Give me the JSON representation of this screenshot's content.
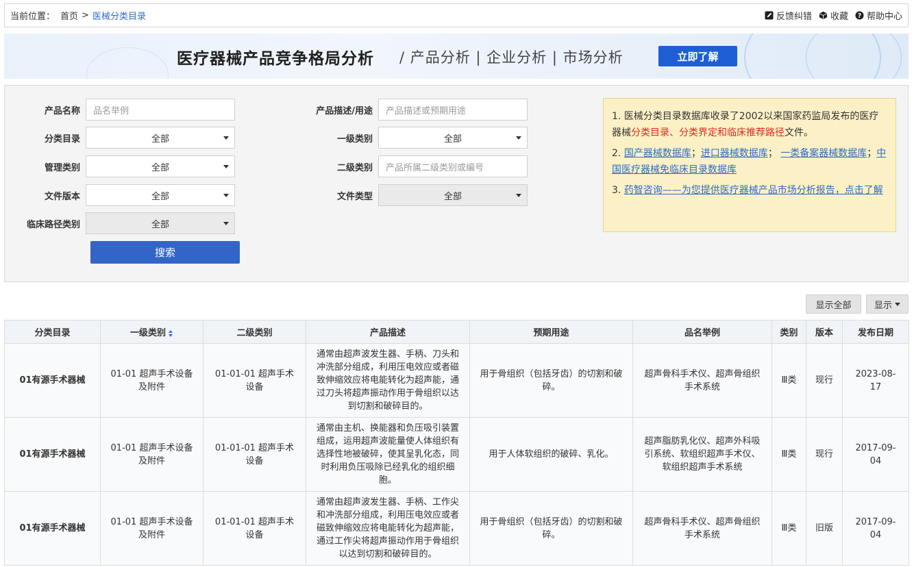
{
  "breadcrumb": {
    "label": "当前位置：",
    "home": "首页",
    "separator": ">",
    "current": "医械分类目录"
  },
  "tools": {
    "feedback": "反馈纠错",
    "favorite": "收藏",
    "help": "帮助中心"
  },
  "banner": {
    "title": "医疗器械产品竞争格局分析",
    "subtitle": "/ 产品分析 | 企业分析 | 市场分析",
    "button": "立即了解"
  },
  "form": {
    "product_name": {
      "label": "产品名称",
      "placeholder": "品名举例"
    },
    "catalog": {
      "label": "分类目录",
      "value": "全部"
    },
    "management": {
      "label": "管理类别",
      "value": "全部"
    },
    "file_version": {
      "label": "文件版本",
      "value": "全部"
    },
    "clinical_path": {
      "label": "临床路径类别",
      "value": "全部"
    },
    "description": {
      "label": "产品描述/用途",
      "placeholder": "产品描述或预期用途"
    },
    "level1": {
      "label": "一级类别",
      "value": "全部"
    },
    "level2": {
      "label": "二级类别",
      "placeholder": "产品所属二级类别或编号"
    },
    "file_type": {
      "label": "文件类型",
      "value": "全部"
    },
    "search_button": "搜索"
  },
  "notice": {
    "line1_a": "1. 医械分类目录数据库收录了2002以来国家药监局发布的医疗器械",
    "line1_red": "分类目录、分类界定和临床推荐路径",
    "line1_b": "文件。",
    "line2_prefix": "2. ",
    "link_domestic": "国产器械数据库",
    "sep1": "；",
    "link_import": "进口器械数据库",
    "sep2": "；",
    "link_class1": "一类备案器械数据库",
    "sep3": "；",
    "link_exempt": "中国医疗器械免临床目录数据库",
    "line3_prefix": "3. ",
    "link_consult": "药智咨询——为您提供医疗器械产品市场分析报告，点击了解"
  },
  "table_controls": {
    "show_all": "显示全部",
    "display": "显示"
  },
  "table": {
    "headers": [
      "分类目录",
      "一级类别",
      "二级类别",
      "产品描述",
      "预期用途",
      "品名举例",
      "类别",
      "版本",
      "发布日期"
    ],
    "rows": [
      {
        "catalog": "01有源手术器械",
        "level1": "01-01 超声手术设备及附件",
        "level2": "01-01-01 超声手术设备",
        "description": "通常由超声波发生器、手柄、刀头和冲洗部分组成，利用压电效应或者磁致伸缩效应将电能转化为超声能，通过刀头将超声振动作用于骨组织以达到切割和破碎目的。",
        "usage": "用于骨组织（包括牙齿）的切割和破碎。",
        "examples": "超声骨科手术仪、超声骨组织手术系统",
        "class": "Ⅲ类",
        "version": "现行",
        "date": "2023-08-17"
      },
      {
        "catalog": "01有源手术器械",
        "level1": "01-01 超声手术设备及附件",
        "level2": "01-01-01 超声手术设备",
        "description": "通常由主机、换能器和负压吸引装置组成，运用超声波能量使人体组织有选择性地被破碎，使其呈乳化态，同时利用负压吸除已经乳化的组织细胞。",
        "usage": "用于人体软组织的破碎、乳化。",
        "examples": "超声脂肪乳化仪、超声外科吸引系统、软组织超声手术仪、软组织超声手术系统",
        "class": "Ⅲ类",
        "version": "现行",
        "date": "2017-09-04"
      },
      {
        "catalog": "01有源手术器械",
        "level1": "01-01 超声手术设备及附件",
        "level2": "01-01-01 超声手术设备",
        "description": "通常由超声波发生器、手柄、工作尖和冲洗部分组成，利用压电效应或者磁致伸缩效应将电能转化为超声能，通过工作尖将超声振动作用于骨组织以达到切割和破碎目的。",
        "usage": "用于骨组织（包括牙齿）的切割和破碎。",
        "examples": "超声骨科手术仪、超声骨组织手术系统",
        "class": "Ⅲ类",
        "version": "旧版",
        "date": "2017-09-04"
      }
    ]
  }
}
